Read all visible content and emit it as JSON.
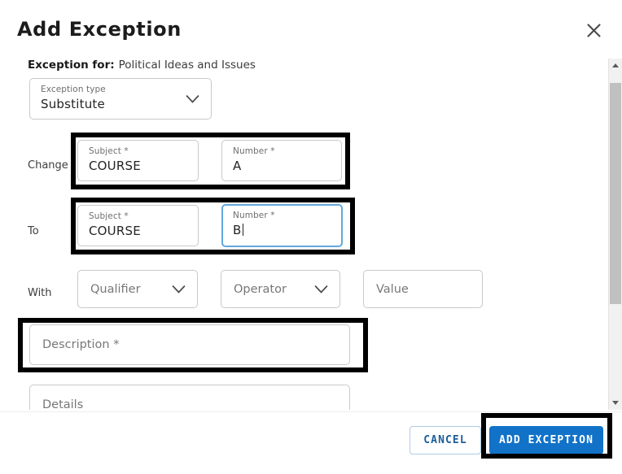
{
  "dialog": {
    "title": "Add Exception",
    "close_icon": "close-icon"
  },
  "context": {
    "label": "Exception for:",
    "value": "Political Ideas and Issues"
  },
  "exception_type": {
    "label": "Exception type",
    "value": "Substitute",
    "chevron_icon": "chevron-down-icon"
  },
  "rows": {
    "change": {
      "label": "Change",
      "subject": {
        "label": "Subject *",
        "value": "COURSE"
      },
      "number": {
        "label": "Number *",
        "value": "A"
      }
    },
    "to": {
      "label": "To",
      "subject": {
        "label": "Subject *",
        "value": "COURSE"
      },
      "number": {
        "label": "Number *",
        "value": "B",
        "focused": true
      }
    },
    "with": {
      "label": "With",
      "qualifier": {
        "placeholder": "Qualifier",
        "value": "",
        "chevron_icon": "chevron-down-icon"
      },
      "operator": {
        "placeholder": "Operator",
        "value": "",
        "chevron_icon": "chevron-down-icon"
      },
      "value_field": {
        "placeholder": "Value",
        "value": ""
      }
    }
  },
  "description": {
    "placeholder": "Description *",
    "value": ""
  },
  "details": {
    "placeholder": "Details",
    "value": ""
  },
  "footer": {
    "cancel_label": "CANCEL",
    "submit_label": "ADD EXCEPTION"
  },
  "scrollbar": {
    "up_icon": "scroll-up-arrow-icon",
    "down_icon": "scroll-down-arrow-icon"
  },
  "colors": {
    "primary_blue": "#1272c8",
    "cancel_text": "#1c5d99",
    "focus_border": "#62a8dd",
    "highlight_box": "#000000"
  }
}
